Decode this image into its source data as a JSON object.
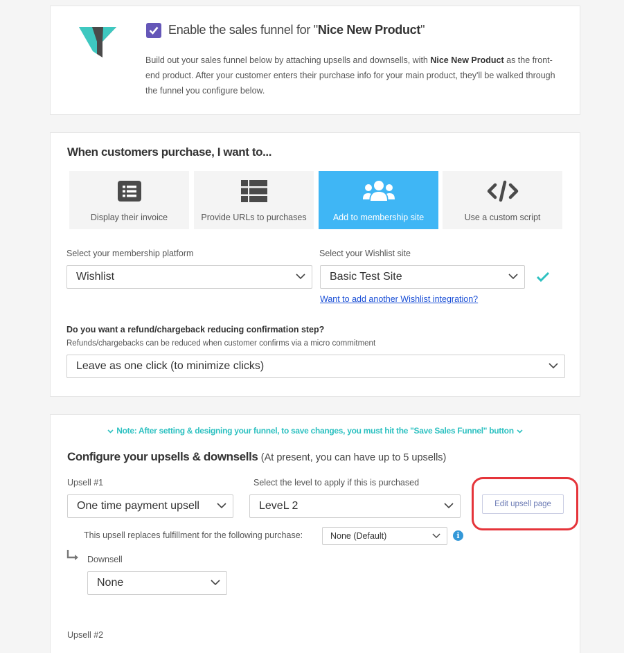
{
  "header": {
    "enable_prefix": "Enable the sales funnel for \"",
    "product_name": "Nice New Product",
    "enable_suffix": "\"",
    "desc_part1": "Build out your sales funnel below by attaching upsells and downsells, with ",
    "desc_product": "Nice New Product",
    "desc_part2": " as the front-end product. After your customer enters their purchase info for your main product, they'll be walked through the funnel you configure below.",
    "checkbox_checked": true,
    "checkbox_color": "#6557b8"
  },
  "purchase_action": {
    "title": "When customers purchase, I want to...",
    "options": [
      {
        "label": "Display their invoice",
        "icon": "invoice-list-icon",
        "active": false
      },
      {
        "label": "Provide URLs to purchases",
        "icon": "list-grid-icon",
        "active": false
      },
      {
        "label": "Add to membership site",
        "icon": "users-icon",
        "active": true
      },
      {
        "label": "Use a custom script",
        "icon": "code-icon",
        "active": false
      }
    ],
    "active_color": "#3fb6f5",
    "platform_label": "Select your membership platform",
    "platform_value": "Wishlist",
    "site_label": "Select your Wishlist site",
    "site_value": "Basic Test Site",
    "add_integration_link": "Want to add another Wishlist integration?",
    "refund_question": "Do you want a refund/chargeback reducing confirmation step?",
    "refund_sub": "Refunds/chargebacks can be reduced when customer confirms via a micro commitment",
    "refund_value": "Leave as one click (to minimize clicks)"
  },
  "upsells": {
    "note": "Note: After setting & designing your funnel, to save changes, you must hit the \"Save Sales Funnel\" button",
    "title": "Configure your upsells & downsells",
    "title_sub": "(At present, you can have up to 5 upsells)",
    "upsell1_label": "Upsell #1",
    "upsell1_value": "One time payment upsell",
    "level_label": "Select the level to apply if this is purchased",
    "level_value": "LeveL 2",
    "edit_button": "Edit upsell page",
    "replaces_label": "This upsell replaces fulfillment for the following purchase:",
    "replaces_value": "None (Default)",
    "info_glyph": "i",
    "downsell_label": "Downsell",
    "downsell_value": "None",
    "upsell2_label": "Upsell #2",
    "accent_color": "#2ec1c1",
    "highlight_color": "#e5343a"
  }
}
